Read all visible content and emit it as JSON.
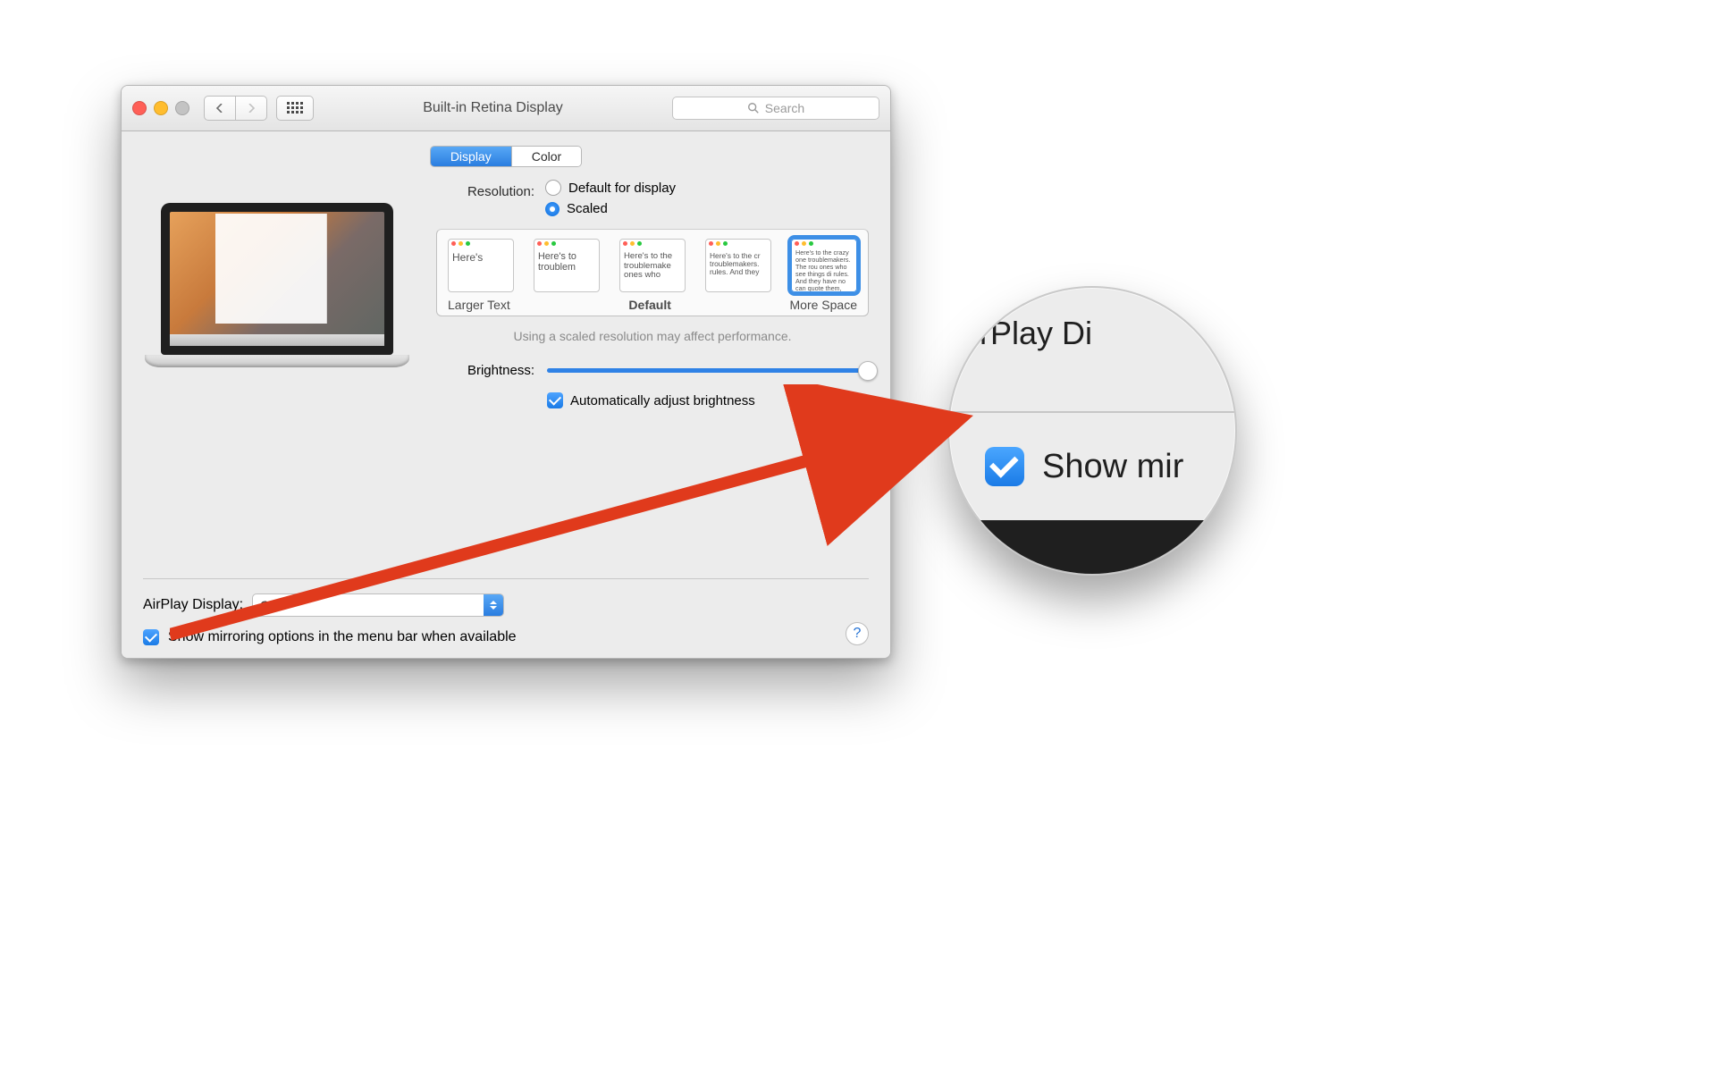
{
  "window": {
    "title": "Built-in Retina Display",
    "search_placeholder": "Search"
  },
  "tabs": {
    "display": "Display",
    "color": "Color"
  },
  "resolution": {
    "label": "Resolution:",
    "default_label": "Default for display",
    "scaled_label": "Scaled",
    "selected": "scaled"
  },
  "scale": {
    "thumbs": [
      {
        "text": "Here's"
      },
      {
        "text": "Here's to troublem"
      },
      {
        "text": "Here's to the troublemake ones who"
      },
      {
        "text": "Here's to the cr troublemakers. rules. And they"
      },
      {
        "text": "Here's to the crazy one troublemakers. The rou ones who see things di rules. And they have no can quote them, disagr them. About the only th Because they change t"
      }
    ],
    "selected_index": 4,
    "left": "Larger Text",
    "mid": "Default",
    "right": "More Space",
    "note": "Using a scaled resolution may affect performance."
  },
  "brightness": {
    "label": "Brightness:",
    "value_percent": 100,
    "auto_label": "Automatically adjust brightness",
    "auto_checked": true
  },
  "airplay": {
    "label": "AirPlay Display:",
    "value": "Off"
  },
  "mirror": {
    "label": "Show mirroring options in the menu bar when available",
    "checked": true
  },
  "help_char": "?",
  "magnifier": {
    "top_text": "irPlay Di",
    "mid_text": "Show mir"
  }
}
